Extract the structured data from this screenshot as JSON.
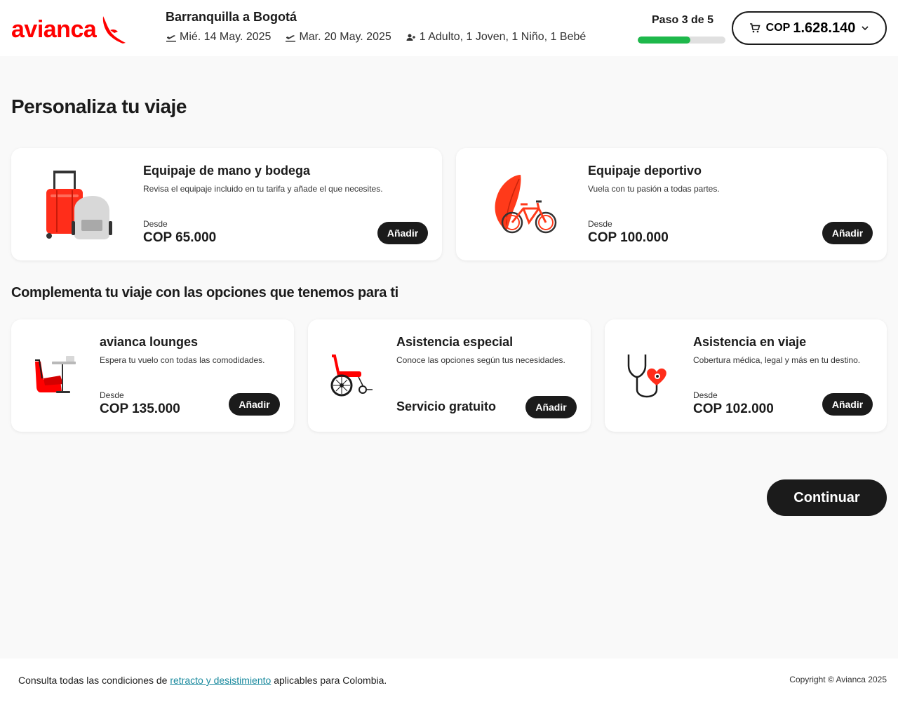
{
  "header": {
    "logo_text": "avianca",
    "route": "Barranquilla a Bogotá",
    "depart_date": "Mié. 14 May. 2025",
    "return_date": "Mar. 20 May. 2025",
    "passengers": "1 Adulto, 1 Joven, 1 Niño, 1 Bebé",
    "step_label": "Paso 3 de 5",
    "step_progress_fraction": 0.6,
    "cart_currency": "COP",
    "cart_amount": "1.628.140"
  },
  "page_title": "Personaliza tu viaje",
  "main_cards": [
    {
      "title": "Equipaje de mano y bodega",
      "desc": "Revisa el equipaje incluido en tu tarifa y añade el que necesites.",
      "from_label": "Desde",
      "price": "COP 65.000",
      "button": "Añadir"
    },
    {
      "title": "Equipaje deportivo",
      "desc": "Vuela con tu pasión a todas partes.",
      "from_label": "Desde",
      "price": "COP 100.000",
      "button": "Añadir"
    }
  ],
  "section_title": "Complementa tu viaje con las opciones que tenemos para ti",
  "extra_cards": [
    {
      "title": "avianca lounges",
      "desc": "Espera tu vuelo con todas las comodidades.",
      "from_label": "Desde",
      "price": "COP 135.000",
      "button": "Añadir"
    },
    {
      "title": "Asistencia especial",
      "desc": "Conoce las opciones según tus necesidades.",
      "price": "Servicio gratuito",
      "button": "Añadir"
    },
    {
      "title": "Asistencia en viaje",
      "desc": "Cobertura médica, legal y más en tu destino.",
      "from_label": "Desde",
      "price": "COP 102.000",
      "button": "Añadir"
    }
  ],
  "continue_label": "Continuar",
  "footer": {
    "legal_prefix": "Consulta todas las condiciones de",
    "legal_link": "retracto y desistimiento",
    "legal_suffix": "aplicables para Colombia.",
    "copyright": "Copyright © Avianca 2025"
  },
  "colors": {
    "brand_red": "#ff0000",
    "progress_green": "#1eb84b",
    "button_dark": "#1b1b1b",
    "link_teal": "#1a8a9e"
  }
}
